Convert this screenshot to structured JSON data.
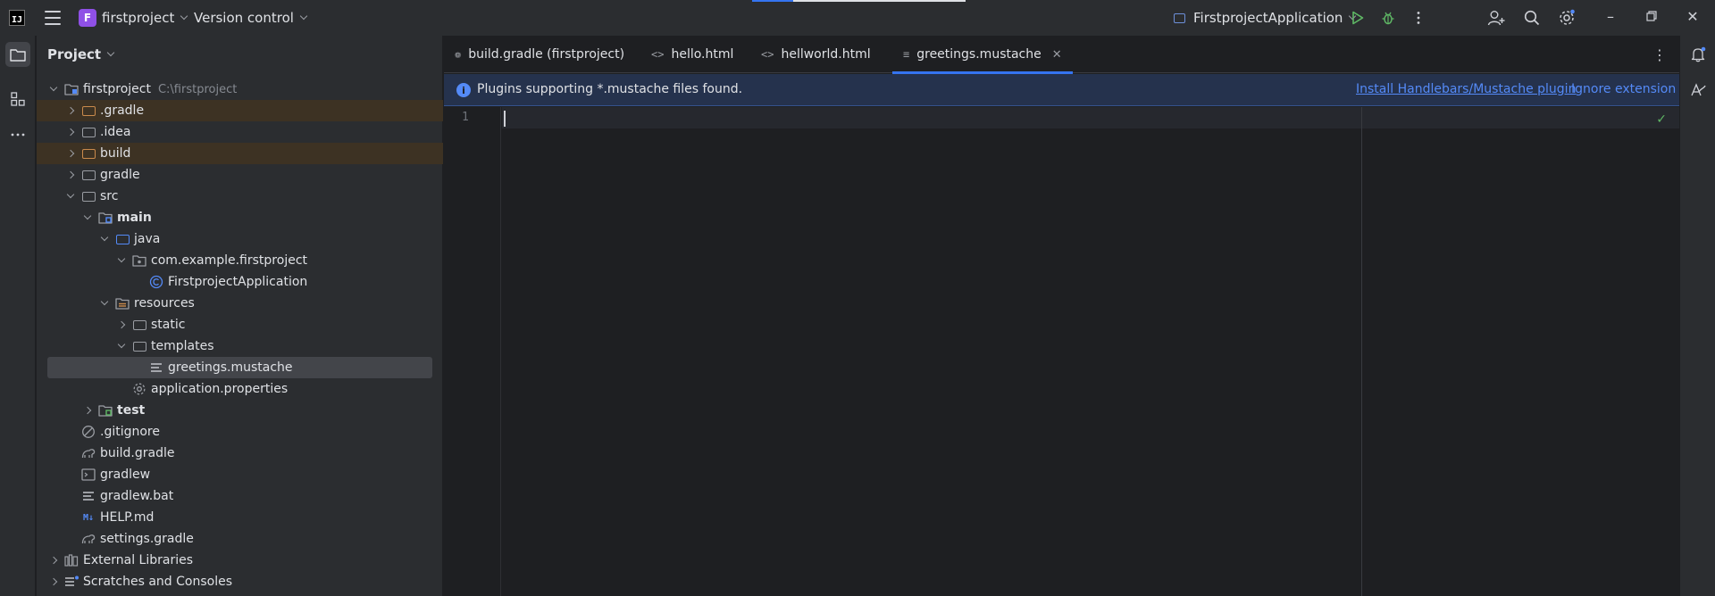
{
  "titlebar": {
    "project_badge": "F",
    "project_name": "firstproject",
    "version_control": "Version control",
    "run_config": "FirstprojectApplication"
  },
  "project_panel": {
    "title": "Project",
    "tree": [
      {
        "label": "firstproject",
        "hint": "C:\\firstproject",
        "level": 0,
        "arrow": "down",
        "icon": "module-folder-icon"
      },
      {
        "label": ".gradle",
        "level": 1,
        "arrow": "right",
        "icon": "excluded-folder-icon",
        "excluded": true
      },
      {
        "label": ".idea",
        "level": 1,
        "arrow": "right",
        "icon": "folder-icon"
      },
      {
        "label": "build",
        "level": 1,
        "arrow": "right",
        "icon": "excluded-folder-icon",
        "excluded": true
      },
      {
        "label": "gradle",
        "level": 1,
        "arrow": "right",
        "icon": "folder-icon"
      },
      {
        "label": "src",
        "level": 1,
        "arrow": "down",
        "icon": "folder-icon"
      },
      {
        "label": "main",
        "level": 2,
        "arrow": "down",
        "icon": "source-root-folder-icon",
        "bold": true
      },
      {
        "label": "java",
        "level": 3,
        "arrow": "down",
        "icon": "source-folder-icon"
      },
      {
        "label": "com.example.firstproject",
        "level": 4,
        "arrow": "down",
        "icon": "package-icon"
      },
      {
        "label": "FirstprojectApplication",
        "level": 5,
        "arrow": "none",
        "icon": "class-icon"
      },
      {
        "label": "resources",
        "level": 3,
        "arrow": "down",
        "icon": "resources-folder-icon"
      },
      {
        "label": "static",
        "level": 4,
        "arrow": "right",
        "icon": "folder-icon"
      },
      {
        "label": "templates",
        "level": 4,
        "arrow": "down",
        "icon": "folder-icon"
      },
      {
        "label": "greetings.mustache",
        "level": 5,
        "arrow": "none",
        "icon": "text-file-icon",
        "selected": true
      },
      {
        "label": "application.properties",
        "level": 4,
        "arrow": "none",
        "icon": "properties-file-icon"
      },
      {
        "label": "test",
        "level": 2,
        "arrow": "right",
        "icon": "test-folder-icon",
        "bold": true
      },
      {
        "label": ".gitignore",
        "level": 1,
        "arrow": "none",
        "icon": "ignore-file-icon"
      },
      {
        "label": "build.gradle",
        "level": 1,
        "arrow": "none",
        "icon": "gradle-file-icon"
      },
      {
        "label": "gradlew",
        "level": 1,
        "arrow": "none",
        "icon": "shell-file-icon"
      },
      {
        "label": "gradlew.bat",
        "level": 1,
        "arrow": "none",
        "icon": "text-file-icon"
      },
      {
        "label": "HELP.md",
        "level": 1,
        "arrow": "none",
        "icon": "markdown-file-icon"
      },
      {
        "label": "settings.gradle",
        "level": 1,
        "arrow": "none",
        "icon": "gradle-file-icon"
      },
      {
        "label": "External Libraries",
        "level": 0,
        "arrow": "right",
        "icon": "library-icon"
      },
      {
        "label": "Scratches and Consoles",
        "level": 0,
        "arrow": "right",
        "icon": "scratches-icon"
      }
    ]
  },
  "tabs": [
    {
      "label": "build.gradle (firstproject)",
      "icon": "gradle-file-icon",
      "active": false
    },
    {
      "label": "hello.html",
      "icon": "html-file-icon",
      "active": false
    },
    {
      "label": "hellworld.html",
      "icon": "html-file-icon",
      "active": false
    },
    {
      "label": "greetings.mustache",
      "icon": "text-file-icon",
      "active": true
    }
  ],
  "banner": {
    "message": "Plugins supporting *.mustache files found.",
    "install_link": "Install Handlebars/Mustache plugin",
    "ignore_link": "Ignore extension"
  },
  "editor": {
    "line_numbers": [
      "1"
    ],
    "content": ""
  },
  "colors": {
    "accent": "#3574f0",
    "panel_bg": "#2b2d30",
    "editor_bg": "#1e1f22",
    "excluded_bg": "#3d3223",
    "selected_bg": "#43454a",
    "project_badge": "#8f50e6"
  }
}
